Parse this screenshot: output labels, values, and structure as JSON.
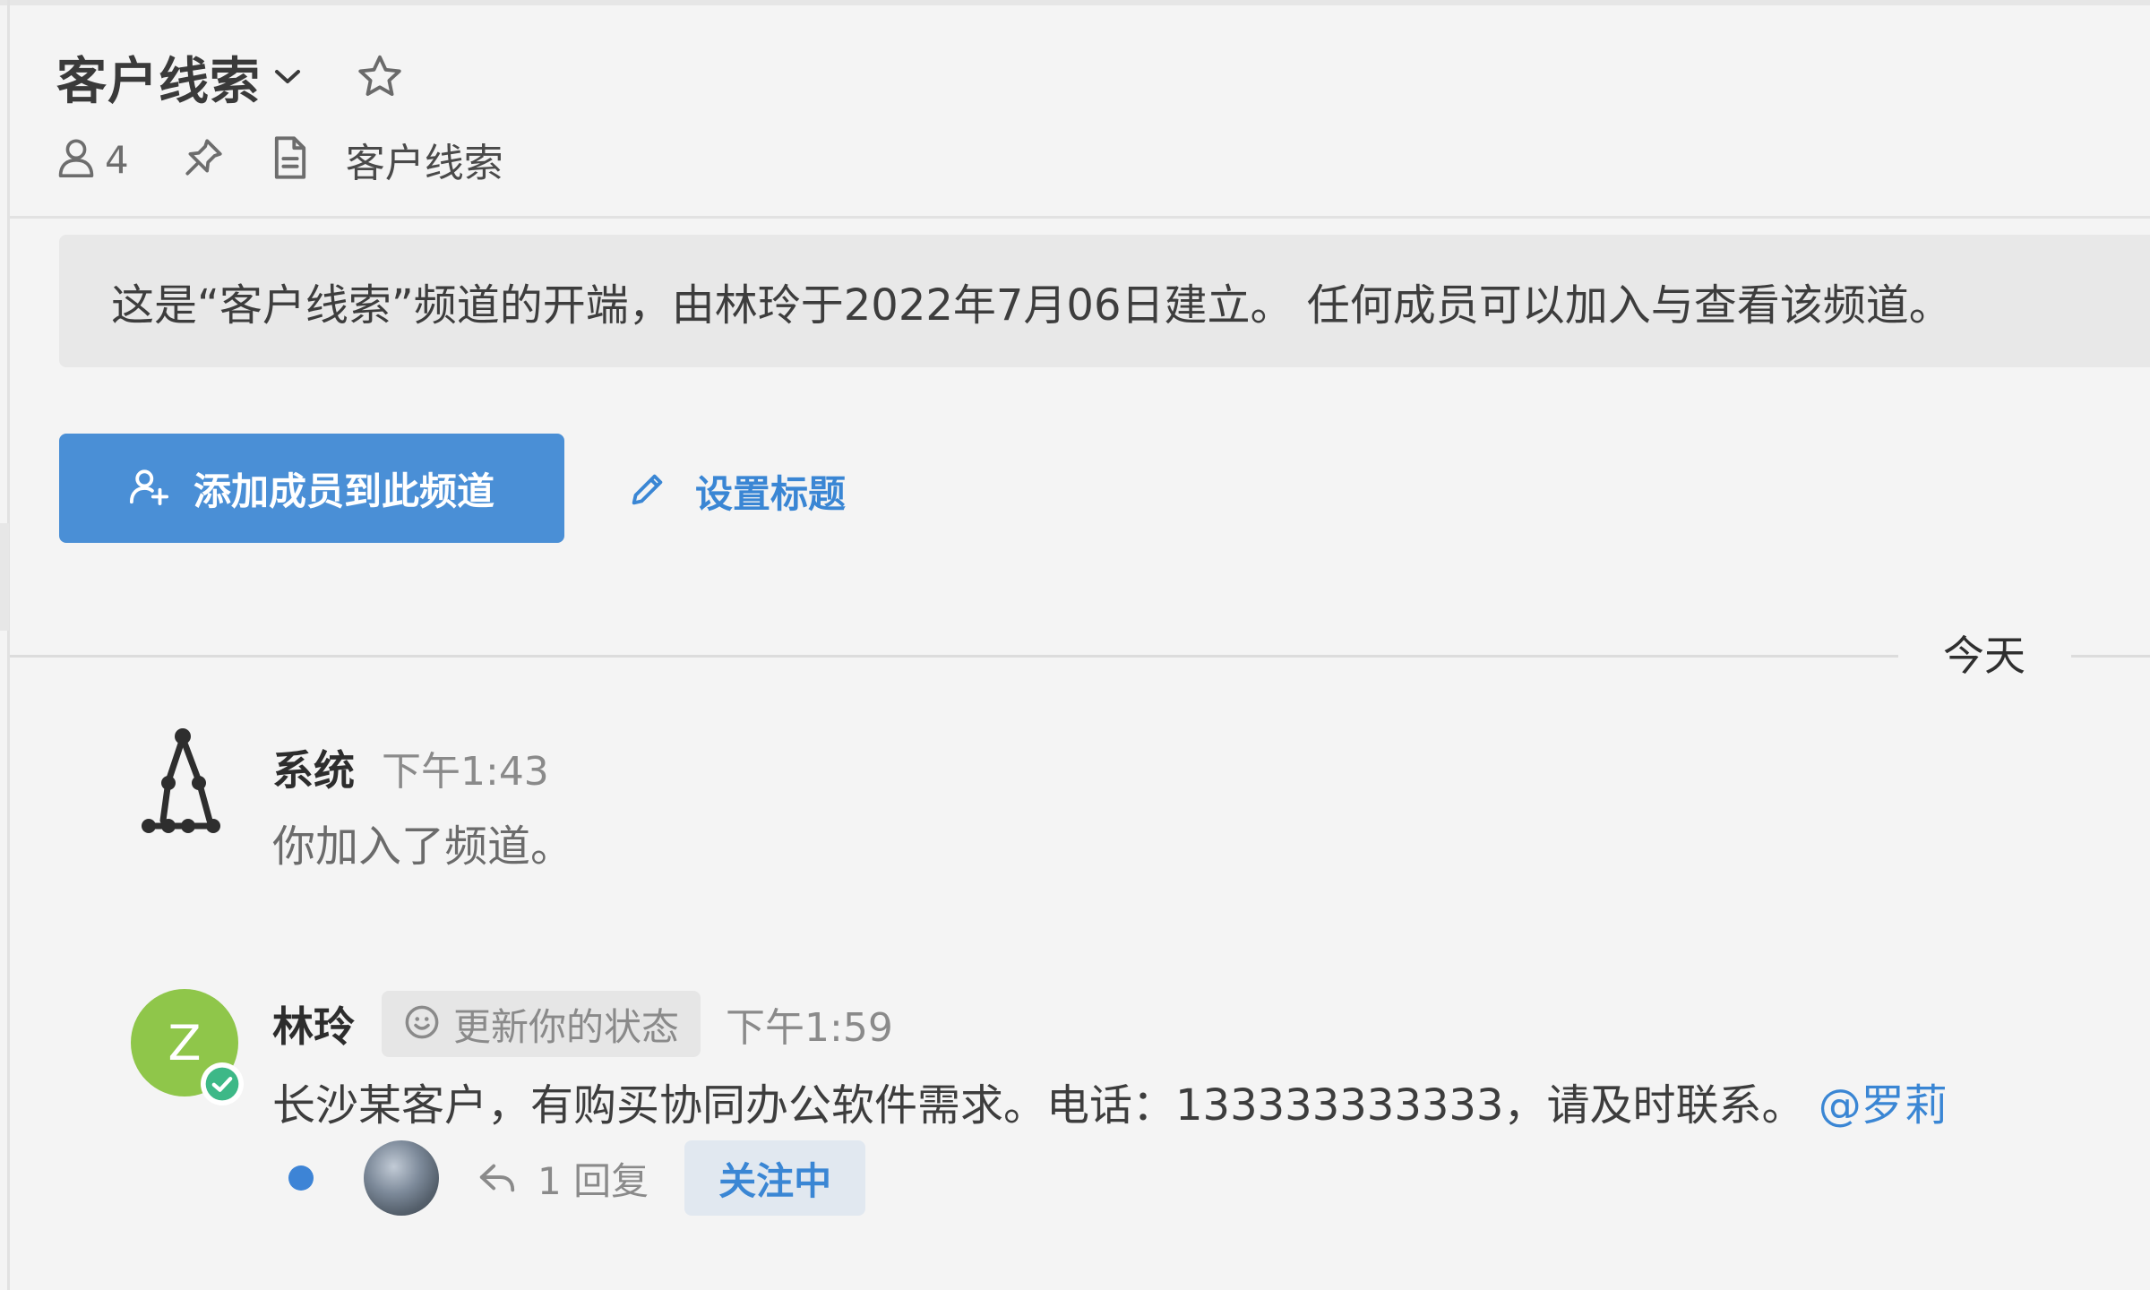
{
  "header": {
    "channel_name": "客户线索",
    "member_count": "4",
    "files_label": "客户线索"
  },
  "intro": {
    "text": "这是“客户线索”频道的开端，由林玲于2022年7月06日建立。 任何成员可以加入与查看该频道。"
  },
  "actions": {
    "add_members_label": "添加成员到此频道",
    "set_title_label": "设置标题"
  },
  "divider": {
    "label": "今天"
  },
  "posts": [
    {
      "author": "系统",
      "time": "下午1:43",
      "message": "你加入了频道。"
    },
    {
      "author": "林玲",
      "avatar_letter": "Z",
      "status_label": "更新你的状态",
      "time": "下午1:59",
      "message": "长沙某客户，有购买协同办公软件需求。电话：133333333333，请及时联系。",
      "mention": "@罗莉",
      "reply_count_label": "1 回复",
      "follow_label": "关注中"
    }
  ],
  "colors": {
    "primary": "#4a8fd6",
    "link": "#3a86d4",
    "avatar_green": "#8fc64a",
    "online_green": "#3db887",
    "unread_dot": "#3d84d6"
  },
  "icons": {
    "chevron": "chevron-down-icon",
    "star": "star-icon",
    "members": "member-icon",
    "pin": "pin-icon",
    "file": "file-icon",
    "add_member": "add-member-icon",
    "edit": "pencil-icon",
    "system": "system-logo-icon",
    "status": "smiley-icon",
    "reply": "reply-icon",
    "online": "online-check-icon"
  }
}
